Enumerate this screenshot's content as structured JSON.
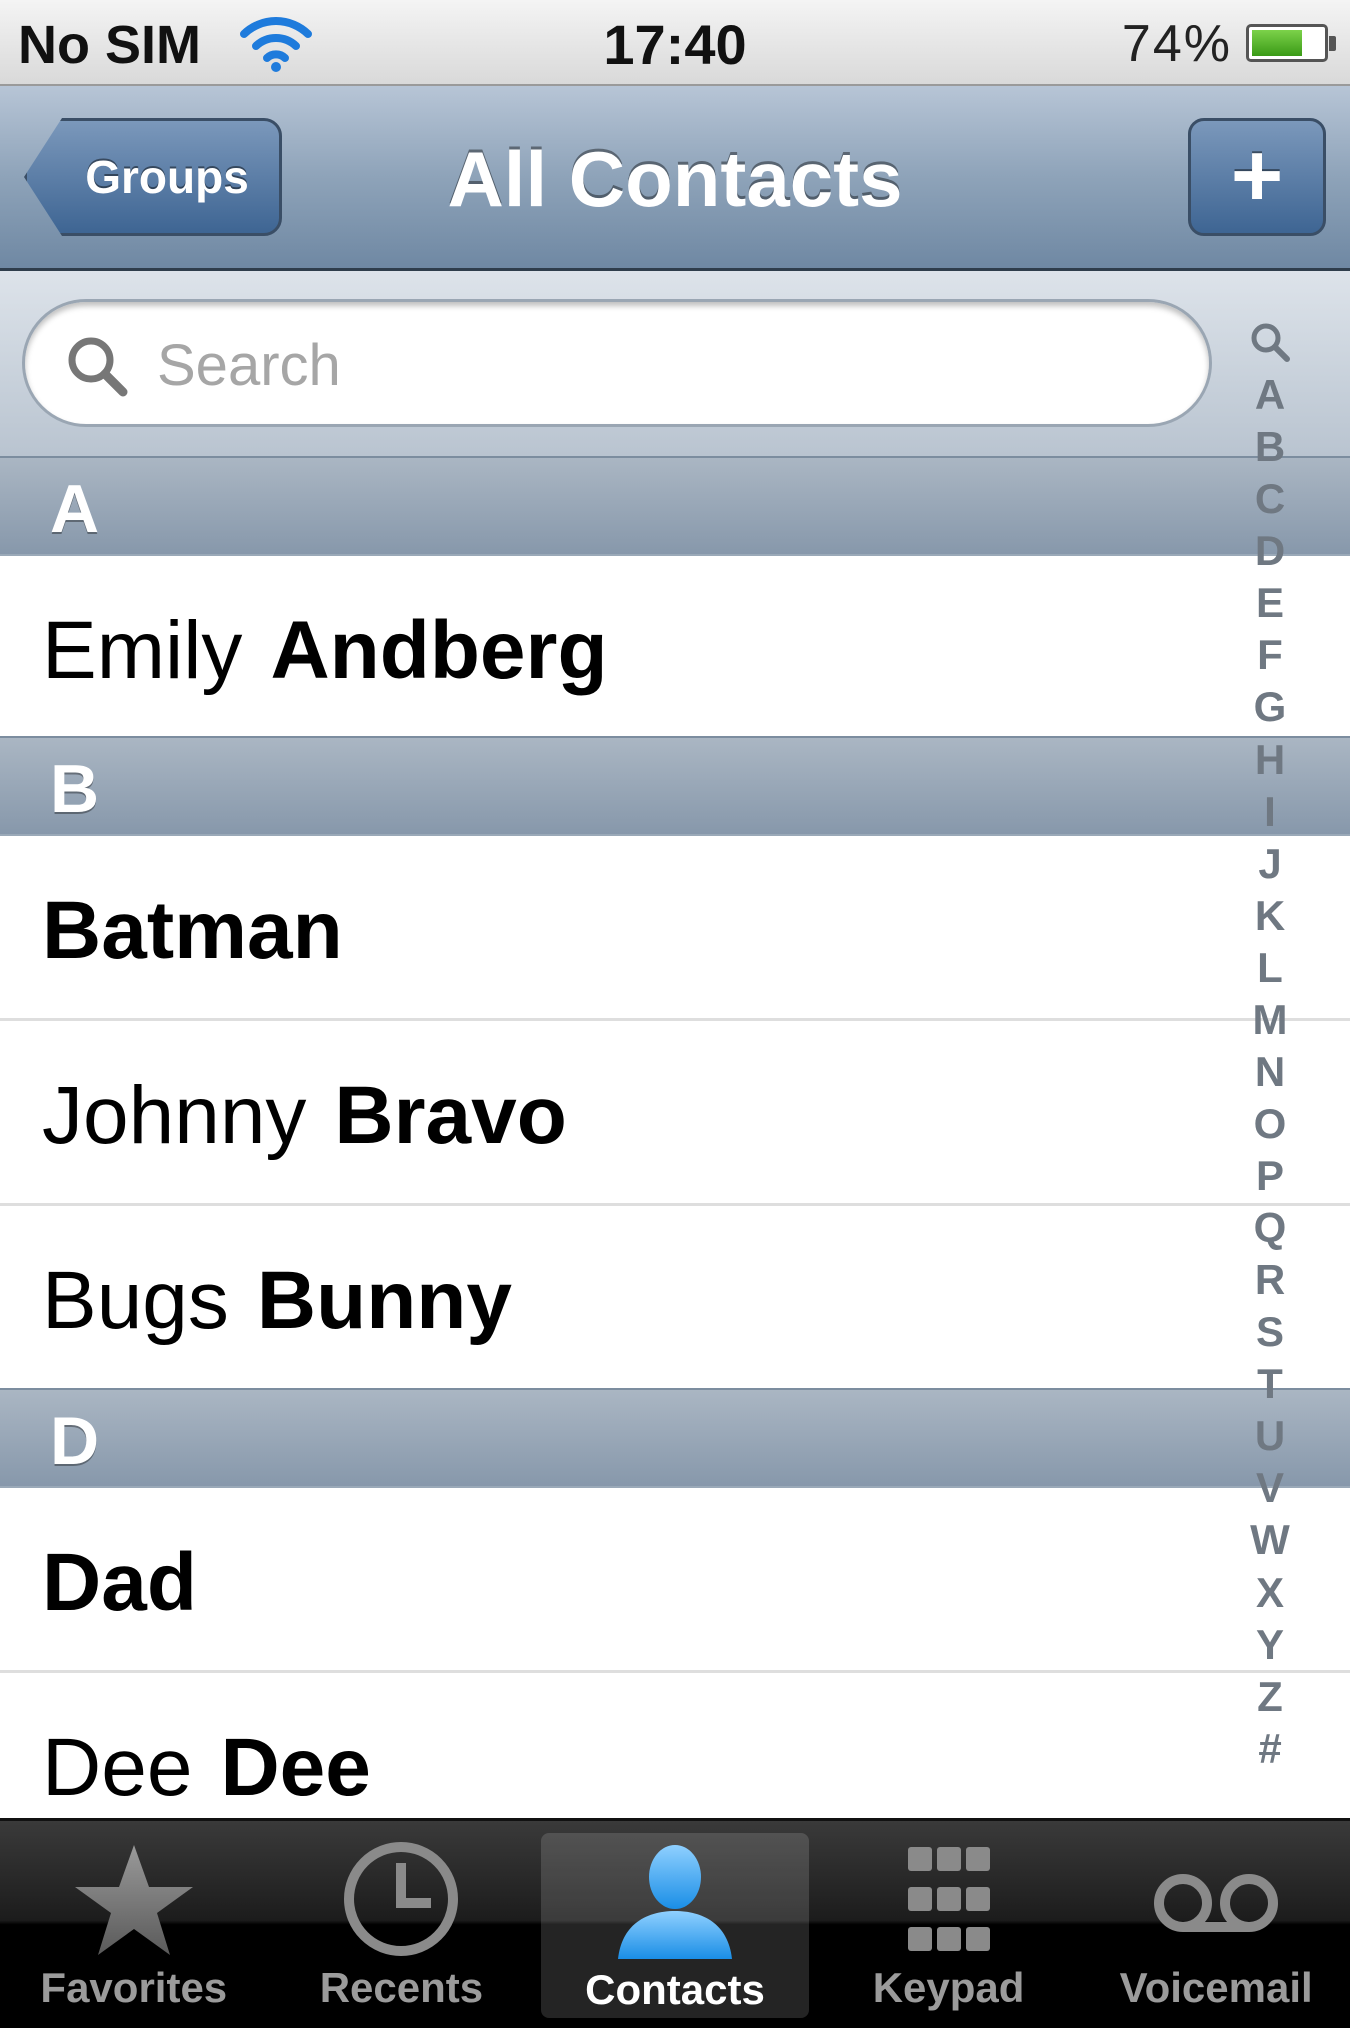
{
  "status_bar": {
    "carrier": "No SIM",
    "time": "17:40",
    "battery_percent_text": "74%",
    "battery_level": 0.74
  },
  "nav": {
    "back_label": "Groups",
    "title": "All Contacts",
    "add_label": "+"
  },
  "search": {
    "placeholder": "Search"
  },
  "sections": [
    {
      "letter": "A",
      "contacts": [
        {
          "first": "Emily",
          "last": "Andberg"
        }
      ]
    },
    {
      "letter": "B",
      "contacts": [
        {
          "first": "",
          "last": "Batman"
        },
        {
          "first": "Johnny",
          "last": "Bravo"
        },
        {
          "first": "Bugs",
          "last": "Bunny"
        }
      ]
    },
    {
      "letter": "D",
      "contacts": [
        {
          "first": "",
          "last": "Dad"
        },
        {
          "first": "Dee",
          "last": "Dee"
        }
      ]
    }
  ],
  "index_letters": [
    "A",
    "B",
    "C",
    "D",
    "E",
    "F",
    "G",
    "H",
    "I",
    "J",
    "K",
    "L",
    "M",
    "N",
    "O",
    "P",
    "Q",
    "R",
    "S",
    "T",
    "U",
    "V",
    "W",
    "X",
    "Y",
    "Z",
    "#"
  ],
  "tabs": [
    {
      "label": "Favorites",
      "icon": "star-icon",
      "active": false
    },
    {
      "label": "Recents",
      "icon": "clock-icon",
      "active": false
    },
    {
      "label": "Contacts",
      "icon": "person-icon",
      "active": true
    },
    {
      "label": "Keypad",
      "icon": "keypad-icon",
      "active": false
    },
    {
      "label": "Voicemail",
      "icon": "voicemail-icon",
      "active": false
    }
  ],
  "colors": {
    "nav_blue": "#6f88a3",
    "active_tab_blue": "#3aa6f0",
    "battery_green": "#5cc22a"
  }
}
